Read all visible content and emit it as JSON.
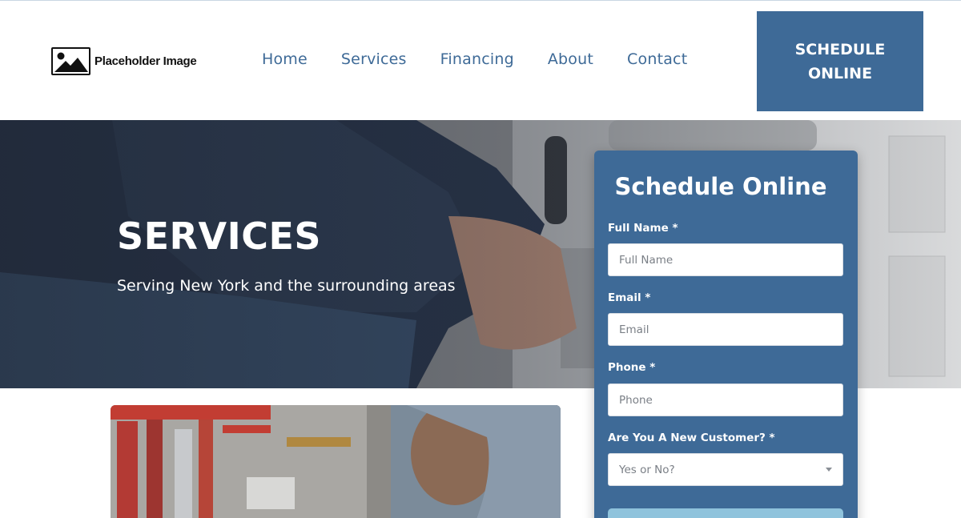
{
  "header": {
    "logo_text": "Placeholder Image",
    "logo_icon": "image-placeholder-icon",
    "nav": [
      "Home",
      "Services",
      "Financing",
      "About",
      "Contact"
    ],
    "cta_label": "SCHEDULE ONLINE"
  },
  "hero": {
    "title": "SERVICES",
    "subtitle": "Serving New York and the surrounding areas"
  },
  "form": {
    "title": "Schedule Online",
    "full_name_label": "Full Name *",
    "full_name_placeholder": "Full Name",
    "email_label": "Email *",
    "email_placeholder": "Email",
    "phone_label": "Phone *",
    "phone_placeholder": "Phone",
    "customer_label": "Are You A New Customer? *",
    "customer_select": "Yes or No?"
  },
  "colors": {
    "primary": "#3e6a97",
    "submit": "#8fc3dc",
    "white": "#ffffff"
  }
}
